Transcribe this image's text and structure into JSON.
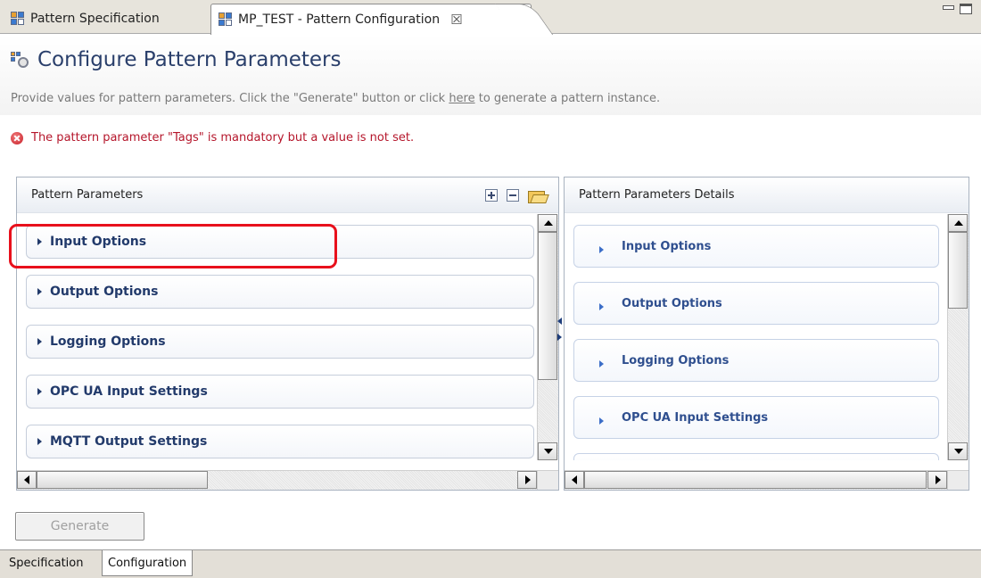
{
  "editor_tabs": [
    {
      "label": "Pattern Specification",
      "icon": "pattern-spec-icon",
      "active": false
    },
    {
      "label": "MP_TEST - Pattern Configuration",
      "icon": "pattern-config-icon",
      "active": true,
      "close": "☒"
    }
  ],
  "header": {
    "title": "Configure Pattern Parameters",
    "description_before": "Provide values for pattern parameters. Click the \"Generate\" button or click ",
    "description_link": "here",
    "description_after": " to generate a pattern instance."
  },
  "error": {
    "message": "The pattern parameter \"Tags\" is mandatory but a value is not set."
  },
  "left_section": {
    "title": "Pattern Parameters",
    "items": [
      {
        "label": "Input Options"
      },
      {
        "label": "Output Options"
      },
      {
        "label": "Logging Options"
      },
      {
        "label": "OPC UA Input Settings"
      },
      {
        "label": "MQTT Output Settings"
      }
    ]
  },
  "right_section": {
    "title": "Pattern Parameters Details",
    "items": [
      {
        "label": "Input Options"
      },
      {
        "label": "Output Options"
      },
      {
        "label": "Logging Options"
      },
      {
        "label": "OPC UA Input Settings"
      }
    ]
  },
  "generate_button": {
    "label": "Generate",
    "enabled": false
  },
  "page_tabs": [
    {
      "label": "Specification",
      "active": false
    },
    {
      "label": "Configuration",
      "active": true
    }
  ],
  "colors": {
    "title": "#2a3f6b",
    "error_text": "#b5162b",
    "highlight_box": "#e8101c",
    "item_text_left": "#223a6b",
    "item_text_right": "#2f4f8f"
  }
}
